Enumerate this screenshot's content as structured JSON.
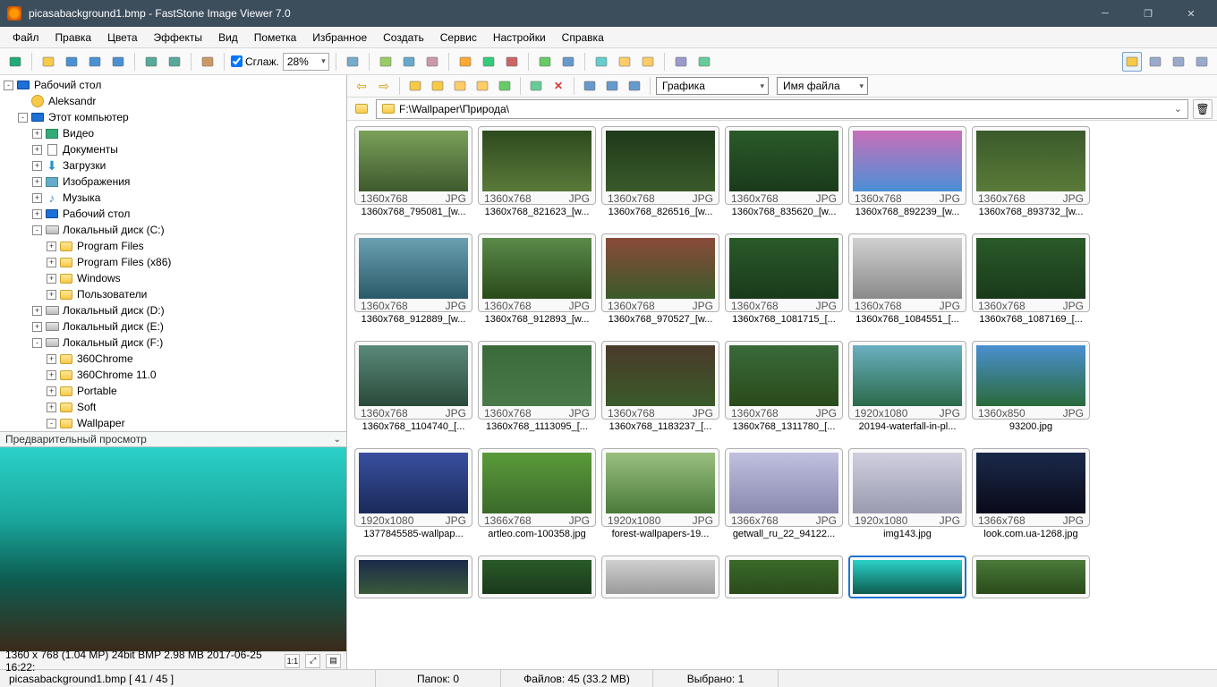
{
  "title": "picasabackground1.bmp  -  FastStone Image Viewer 7.0",
  "menu": [
    "Файл",
    "Правка",
    "Цвета",
    "Эффекты",
    "Вид",
    "Пометка",
    "Избранное",
    "Создать",
    "Сервис",
    "Настройки",
    "Справка"
  ],
  "toolbar": {
    "smooth": "Сглаж.",
    "zoom": "28%"
  },
  "browser_toolbar": {
    "filter": "Графика",
    "sort": "Имя файла"
  },
  "path": "F:\\Wallpaper\\Природа\\",
  "tree": [
    {
      "d": 0,
      "e": "-",
      "i": "monitor",
      "t": "Рабочий стол"
    },
    {
      "d": 1,
      "e": " ",
      "i": "user",
      "t": "Aleksandr"
    },
    {
      "d": 1,
      "e": "-",
      "i": "monitor",
      "t": "Этот компьютер"
    },
    {
      "d": 2,
      "e": "+",
      "i": "video",
      "t": "Видео"
    },
    {
      "d": 2,
      "e": "+",
      "i": "doc",
      "t": "Документы"
    },
    {
      "d": 2,
      "e": "+",
      "i": "down",
      "t": "Загрузки"
    },
    {
      "d": 2,
      "e": "+",
      "i": "pic",
      "t": "Изображения"
    },
    {
      "d": 2,
      "e": "+",
      "i": "music",
      "t": "Музыка"
    },
    {
      "d": 2,
      "e": "+",
      "i": "monitor",
      "t": "Рабочий стол"
    },
    {
      "d": 2,
      "e": "-",
      "i": "drive",
      "t": "Локальный диск (C:)"
    },
    {
      "d": 3,
      "e": "+",
      "i": "folder",
      "t": "Program Files"
    },
    {
      "d": 3,
      "e": "+",
      "i": "folder",
      "t": "Program Files (x86)"
    },
    {
      "d": 3,
      "e": "+",
      "i": "folder",
      "t": "Windows"
    },
    {
      "d": 3,
      "e": "+",
      "i": "folder",
      "t": "Пользователи"
    },
    {
      "d": 2,
      "e": "+",
      "i": "drive",
      "t": "Локальный диск (D:)"
    },
    {
      "d": 2,
      "e": "+",
      "i": "drive",
      "t": "Локальный диск (E:)"
    },
    {
      "d": 2,
      "e": "-",
      "i": "drive",
      "t": "Локальный диск (F:)"
    },
    {
      "d": 3,
      "e": "+",
      "i": "folder",
      "t": "360Chrome"
    },
    {
      "d": 3,
      "e": "+",
      "i": "folder",
      "t": "360Chrome 11.0"
    },
    {
      "d": 3,
      "e": "+",
      "i": "folder",
      "t": "Portable"
    },
    {
      "d": 3,
      "e": "+",
      "i": "folder",
      "t": "Soft"
    },
    {
      "d": 3,
      "e": "-",
      "i": "folder",
      "t": "Wallpaper"
    }
  ],
  "preview": {
    "header": "Предварительный просмотр",
    "info": "1360 x 768 (1.04 MP)   24bit   BMP    2.98 MB    2017-06-25 16:22:",
    "ratio": "1:1"
  },
  "thumbs": [
    {
      "r": "1360x768",
      "f": "JPG",
      "n": "1360x768_795081_[w...",
      "bg": "linear-gradient(#7aa05a,#3e5a2e)"
    },
    {
      "r": "1360x768",
      "f": "JPG",
      "n": "1360x768_821623_[w...",
      "bg": "linear-gradient(#2d4a1e,#5a7a3a)"
    },
    {
      "r": "1360x768",
      "f": "JPG",
      "n": "1360x768_826516_[w...",
      "bg": "linear-gradient(#1e3a1a,#3a5a2a)"
    },
    {
      "r": "1360x768",
      "f": "JPG",
      "n": "1360x768_835620_[w...",
      "bg": "linear-gradient(#2a5a2a,#1a3a1a)"
    },
    {
      "r": "1360x768",
      "f": "JPG",
      "n": "1360x768_892239_[w...",
      "bg": "linear-gradient(#c96fb9,#4a8fd6)"
    },
    {
      "r": "1360x768",
      "f": "JPG",
      "n": "1360x768_893732_[w...",
      "bg": "linear-gradient(#3a5a2a,#5a7a3a)"
    },
    {
      "r": "1360x768",
      "f": "JPG",
      "n": "1360x768_912889_[w...",
      "bg": "linear-gradient(#6aa0b0,#2a5a6a)"
    },
    {
      "r": "1360x768",
      "f": "JPG",
      "n": "1360x768_912893_[w...",
      "bg": "linear-gradient(#5a8a4a,#2a4a1a)"
    },
    {
      "r": "1360x768",
      "f": "JPG",
      "n": "1360x768_970527_[w...",
      "bg": "linear-gradient(#8a4a3a,#3a5a2a)"
    },
    {
      "r": "1360x768",
      "f": "JPG",
      "n": "1360x768_1081715_[...",
      "bg": "linear-gradient(#2a5a2a,#1a3a1a)"
    },
    {
      "r": "1360x768",
      "f": "JPG",
      "n": "1360x768_1084551_[...",
      "bg": "linear-gradient(#d0d0d0,#8a8a8a)"
    },
    {
      "r": "1360x768",
      "f": "JPG",
      "n": "1360x768_1087169_[...",
      "bg": "linear-gradient(#2a5a2a,#1a3a1a)"
    },
    {
      "r": "1360x768",
      "f": "JPG",
      "n": "1360x768_1104740_[...",
      "bg": "linear-gradient(#5a8a7a,#2a4a3a)"
    },
    {
      "r": "1360x768",
      "f": "JPG",
      "n": "1360x768_1113095_[...",
      "bg": "linear-gradient(#3a6a3a,#4a7a4a)"
    },
    {
      "r": "1360x768",
      "f": "JPG",
      "n": "1360x768_1183237_[...",
      "bg": "linear-gradient(#4a3a2a,#3a5a2a)"
    },
    {
      "r": "1360x768",
      "f": "JPG",
      "n": "1360x768_1311780_[...",
      "bg": "linear-gradient(#3a6a3a,#2a4a1a)"
    },
    {
      "r": "1920x1080",
      "f": "JPG",
      "n": "20194-waterfall-in-pl...",
      "bg": "linear-gradient(#6ab0c0,#2a6a4a)"
    },
    {
      "r": "1360x850",
      "f": "JPG",
      "n": "93200.jpg",
      "bg": "linear-gradient(#4a90d0,#2a6a3a)"
    },
    {
      "r": "1920x1080",
      "f": "JPG",
      "n": "1377845585-wallpap...",
      "bg": "linear-gradient(#3a50a0,#1a2a5a)"
    },
    {
      "r": "1366x768",
      "f": "JPG",
      "n": "artleo.com-100358.jpg",
      "bg": "linear-gradient(#5a9a3a,#3a6a2a)"
    },
    {
      "r": "1920x1080",
      "f": "JPG",
      "n": "forest-wallpapers-19...",
      "bg": "linear-gradient(#9ac080,#4a7a3a)"
    },
    {
      "r": "1366x768",
      "f": "JPG",
      "n": "getwall_ru_22_94122...",
      "bg": "linear-gradient(#c0c0e0,#8a8ab0)"
    },
    {
      "r": "1920x1080",
      "f": "JPG",
      "n": "img143.jpg",
      "bg": "linear-gradient(#d0d0e0,#9a9ab0)",
      "sel": false
    },
    {
      "r": "1366x768",
      "f": "JPG",
      "n": "look.com.ua-1268.jpg",
      "bg": "linear-gradient(#1a2a4a,#0a0a1a)"
    },
    {
      "r": "",
      "f": "",
      "n": "",
      "bg": "linear-gradient(#1a2a4a,#3a5a3a)",
      "half": true
    },
    {
      "r": "",
      "f": "",
      "n": "",
      "bg": "linear-gradient(#2a5a2a,#1a3a1a)",
      "half": true
    },
    {
      "r": "",
      "f": "",
      "n": "",
      "bg": "linear-gradient(#d0d0d0,#9a9a9a)",
      "half": true
    },
    {
      "r": "",
      "f": "",
      "n": "",
      "bg": "linear-gradient(#3a6a2a,#2a4a1a)",
      "half": true
    },
    {
      "r": "",
      "f": "",
      "n": "",
      "bg": "linear-gradient(#2bd1c8,#0d5c50)",
      "half": true,
      "sel": true
    },
    {
      "r": "",
      "f": "",
      "n": "",
      "bg": "linear-gradient(#4a7a3a,#2a4a1a)",
      "half": true
    }
  ],
  "status": {
    "file": "picasabackground1.bmp  [ 41 / 45 ]",
    "folders": "Папок: 0",
    "files": "Файлов: 45 (33.2 MB)",
    "selected": "Выбрано: 1"
  },
  "toolbar_icons": [
    "acquire",
    "open",
    "save",
    "save-left",
    "save-right",
    "zoom-in",
    "zoom-out",
    "hand",
    "rotate",
    "crop",
    "resize",
    "canvas",
    "color",
    "redeye",
    "clone",
    "undo",
    "compare",
    "copy",
    "mail",
    "email",
    "print",
    "tag"
  ],
  "view_icons": [
    "thumbs-view",
    "details-view",
    "contact-view",
    "fullscreen-view"
  ],
  "browser_icons": [
    "back",
    "forward",
    "up",
    "new-folder",
    "favorites",
    "fav-add",
    "refresh",
    "tag",
    "delete",
    "view-large",
    "view-list",
    "view-details"
  ]
}
